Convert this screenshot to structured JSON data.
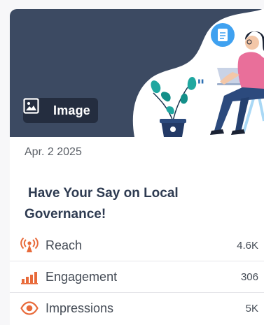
{
  "post": {
    "media_badge": "Image",
    "date": "Apr. 2 2025",
    "title": "Have Your Say on Local Governance!"
  },
  "metrics": [
    {
      "label": "Reach",
      "value": "4.6K",
      "icon": "broadcast-icon"
    },
    {
      "label": "Engagement",
      "value": "306",
      "icon": "bar-chart-icon"
    },
    {
      "label": "Impressions",
      "value": "5K",
      "icon": "eye-icon"
    }
  ],
  "colors": {
    "hero_bg": "#3c4a62",
    "title": "#2e3b51",
    "metric_icon": "#e86a3a",
    "person_top": "#e96f9a",
    "person_pants": "#2c4a7d",
    "plant": "#1fa7a0"
  }
}
